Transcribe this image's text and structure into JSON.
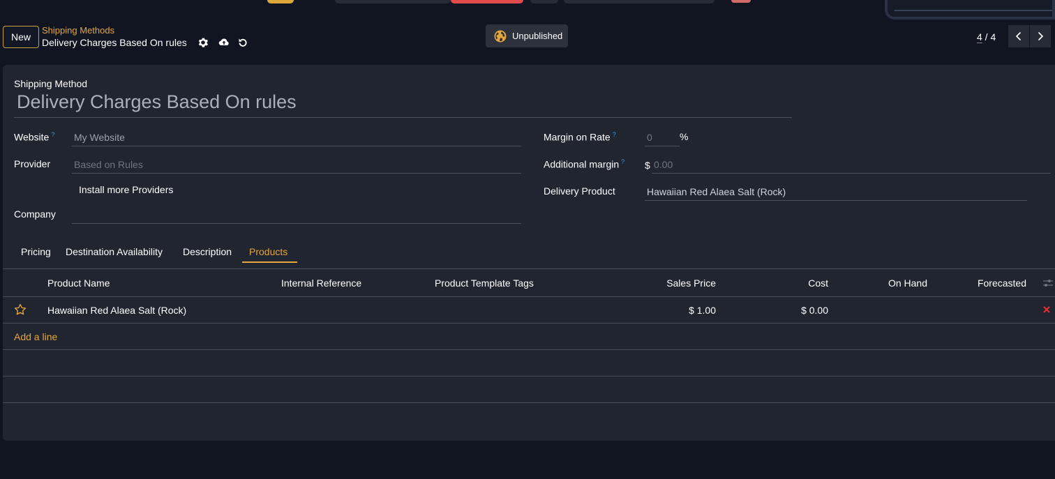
{
  "control_panel": {
    "new_label": "New",
    "breadcrumb_parent": "Shipping Methods",
    "breadcrumb_current": "Delivery Charges Based On rules",
    "status_label": "Unpublished",
    "pager_value": "4",
    "pager_separator": " / ",
    "pager_total": "4"
  },
  "form": {
    "shipping_method_label": "Shipping Method",
    "shipping_method_value": "Delivery Charges Based On rules",
    "fields": {
      "website_label": "Website",
      "website_value": "My Website",
      "provider_label": "Provider",
      "provider_value": "Based on Rules",
      "install_link": "Install more Providers",
      "company_label": "Company",
      "company_value": "",
      "margin_rate_label": "Margin on Rate",
      "margin_rate_value": "0",
      "margin_rate_unit": "%",
      "additional_margin_label": "Additional margin",
      "additional_margin_currency": "$",
      "additional_margin_value": "0.00",
      "delivery_product_label": "Delivery Product",
      "delivery_product_value": "Hawaiian Red Alaea Salt (Rock)"
    },
    "help_marker": "?"
  },
  "tabs": [
    {
      "label": "Pricing"
    },
    {
      "label": "Destination Availability"
    },
    {
      "label": "Description"
    },
    {
      "label": "Products",
      "active": true
    }
  ],
  "table": {
    "headers": [
      "Product Name",
      "Internal Reference",
      "Product Template Tags",
      "Sales Price",
      "Cost",
      "On Hand",
      "Forecasted"
    ],
    "rows": [
      {
        "product_name": "Hawaiian Red Alaea Salt (Rock)",
        "internal_reference": "",
        "tags": "",
        "sales_price": "$ 1.00",
        "cost": "$ 0.00",
        "on_hand": "",
        "forecasted": ""
      }
    ],
    "add_line_label": "Add a line"
  },
  "colors": {
    "accent": "#e5a53d",
    "background": "#111522",
    "sheet": "#212530",
    "delete": "#e02d2d"
  }
}
